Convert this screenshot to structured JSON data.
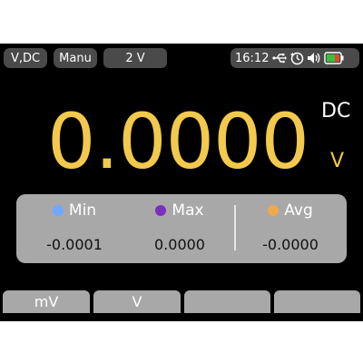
{
  "status_bar": {
    "mode": "V,DC",
    "range_mode": "Manu",
    "range": "2 V",
    "time": "16:12",
    "icons": [
      "usb-icon",
      "auto-hold-timer-icon",
      "speaker-icon",
      "battery-icon"
    ],
    "battery_colors": {
      "fill": "#3bbf3b",
      "accent": "#e04a2a"
    }
  },
  "reading": {
    "value": "0.0000",
    "coupling": "DC",
    "unit": "V"
  },
  "stats": {
    "min": {
      "label": "Min",
      "value": "-0.0001",
      "color": "#6ea8ff"
    },
    "max": {
      "label": "Max",
      "value": "0.0000",
      "color": "#7a2fbf"
    },
    "avg": {
      "label": "Avg",
      "value": "-0.0000",
      "color": "#f0a94a"
    }
  },
  "softkeys": [
    "mV",
    "V",
    "",
    ""
  ],
  "colors": {
    "reading": "#f2c94c",
    "panel": "#a8a8a8",
    "screen": "#000000"
  }
}
